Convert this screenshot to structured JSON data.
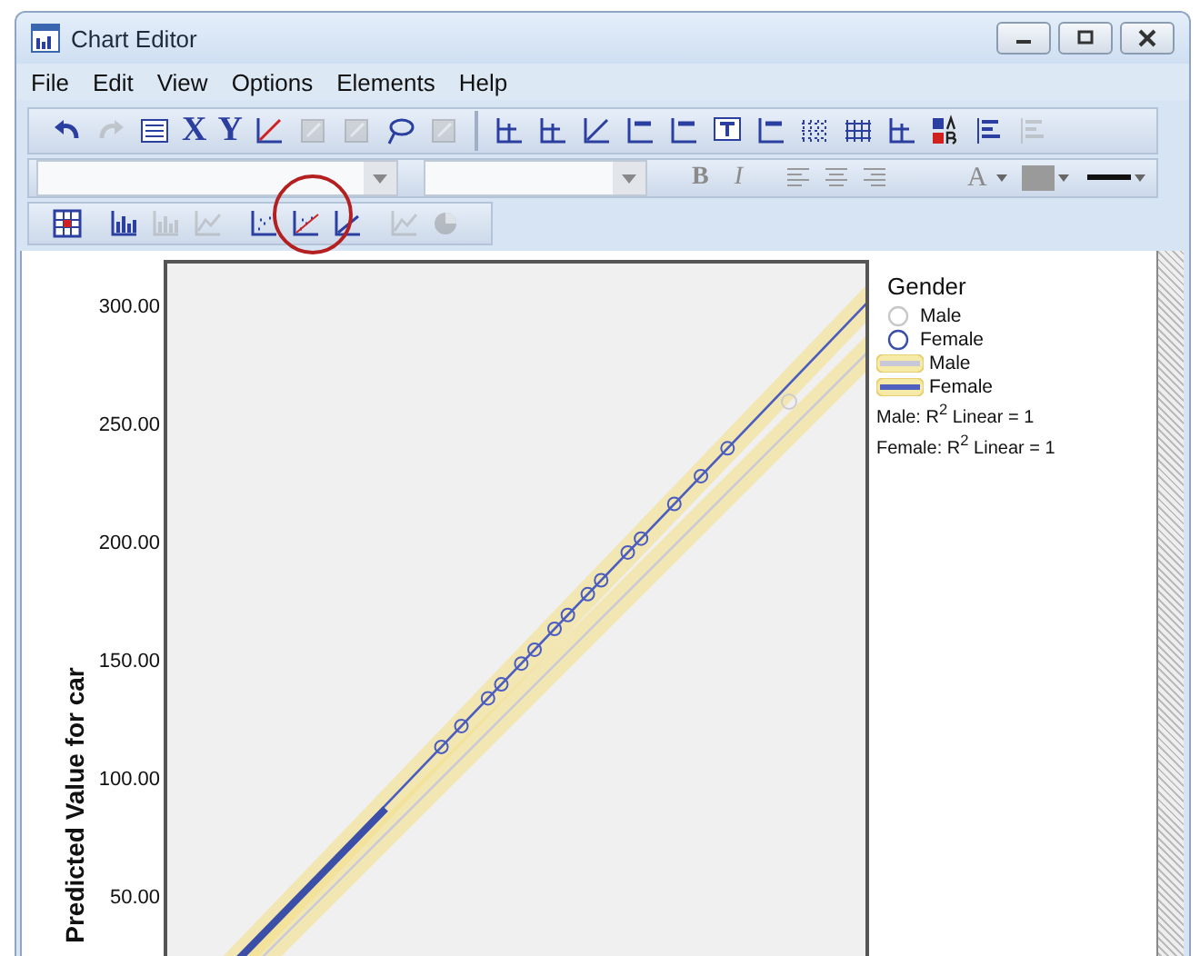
{
  "window": {
    "title": "Chart Editor"
  },
  "menu": [
    {
      "label": "File"
    },
    {
      "label": "Edit"
    },
    {
      "label": "View"
    },
    {
      "label": "Options"
    },
    {
      "label": "Elements"
    },
    {
      "label": "Help"
    }
  ],
  "main_toolbar": [
    {
      "kind": "undo",
      "disabled": false
    },
    {
      "kind": "redo",
      "disabled": true
    },
    {
      "kind": "properties",
      "disabled": false
    },
    {
      "kind": "letter",
      "text": "X",
      "disabled": false
    },
    {
      "kind": "letter",
      "text": "Y",
      "disabled": false
    },
    {
      "kind": "select",
      "disabled": false
    },
    {
      "kind": "resize",
      "disabled": true
    },
    {
      "kind": "pages",
      "disabled": true
    },
    {
      "kind": "lasso",
      "disabled": false
    },
    {
      "kind": "window",
      "disabled": true
    },
    {
      "kind": "separator"
    },
    {
      "kind": "yline",
      "disabled": false
    },
    {
      "kind": "xline",
      "disabled": false
    },
    {
      "kind": "fit",
      "disabled": false
    },
    {
      "kind": "title",
      "disabled": false
    },
    {
      "kind": "legend",
      "disabled": false
    },
    {
      "kind": "textbox",
      "disabled": false
    },
    {
      "kind": "footnote",
      "disabled": false
    },
    {
      "kind": "dots",
      "disabled": false
    },
    {
      "kind": "grid",
      "disabled": false
    },
    {
      "kind": "frame",
      "disabled": false
    },
    {
      "kind": "colors",
      "disabled": false
    },
    {
      "kind": "align",
      "disabled": false
    },
    {
      "kind": "bars",
      "disabled": true
    }
  ],
  "format_toolbar": {
    "font_field": {
      "disabled": true
    },
    "size_field": {
      "disabled": true
    },
    "bold": "B",
    "italic": "I",
    "text_color": "A"
  },
  "element_toolbar": [
    {
      "kind": "table",
      "disabled": false
    },
    {
      "kind": "barchart",
      "disabled": false
    },
    {
      "kind": "barchart",
      "disabled": true
    },
    {
      "kind": "linechart",
      "disabled": true
    },
    {
      "kind": "scatter",
      "disabled": false
    },
    {
      "kind": "scatterfit",
      "disabled": false
    },
    {
      "kind": "fit",
      "disabled": false
    },
    {
      "kind": "area",
      "disabled": true
    },
    {
      "kind": "pie",
      "disabled": true
    }
  ],
  "chart": {
    "ylabel": "Predicted Value for car",
    "yticks": [
      "300.00",
      "250.00",
      "200.00",
      "150.00",
      "100.00",
      "50.00"
    ],
    "legend": {
      "title": "Gender",
      "items": [
        {
          "kind": "marker",
          "label": "Male",
          "color": "#c8c8c8",
          "selected": false
        },
        {
          "kind": "marker",
          "label": "Female",
          "color": "#3b4fa8",
          "selected": false
        },
        {
          "kind": "line",
          "label": "Male",
          "color": "#c8c8d8",
          "selected": true
        },
        {
          "kind": "line",
          "label": "Female",
          "color": "#5060c0",
          "selected": true
        }
      ]
    },
    "fit_notes": [
      "Male: R$^{2}$ Linear = 1",
      "Female: R$^{2}$ Linear = 1"
    ]
  }
}
